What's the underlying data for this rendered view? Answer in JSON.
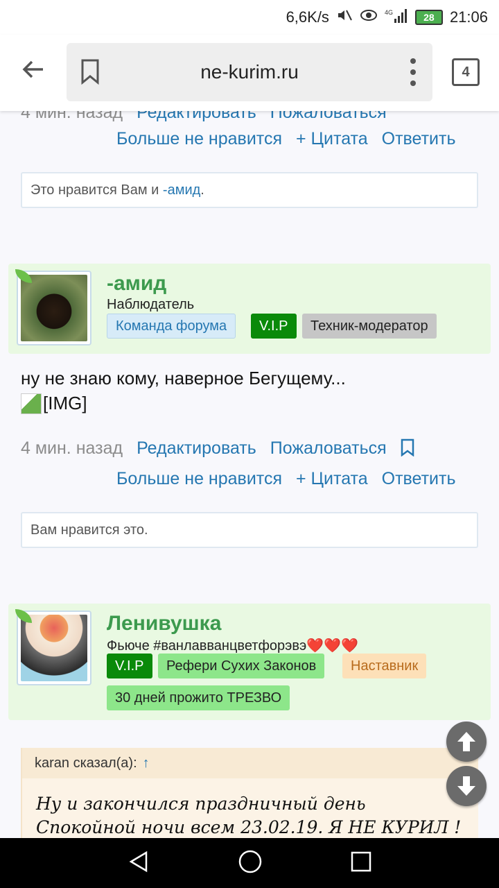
{
  "status_bar": {
    "speed": "6,6K/s",
    "network": "4G",
    "battery": "28",
    "time": "21:06"
  },
  "browser": {
    "url": "ne-kurim.ru",
    "tab_count": "4"
  },
  "post1": {
    "meta_time": "4 мин. назад",
    "edit": "Редактировать",
    "report": "Пожаловаться",
    "unlike": "Больше не нравится",
    "quote": "+ Цитата",
    "reply": "Ответить",
    "likes_prefix": "Это нравится Вам и ",
    "likes_user": "-амид",
    "likes_suffix": "."
  },
  "post2": {
    "username": "-амид",
    "user_title": "Наблюдатель",
    "badges": [
      {
        "label": "Команда форума",
        "bg": "#d7ebf8",
        "color": "#2577b1"
      },
      {
        "label": "V.I.P",
        "bg": "#0a8a0a",
        "color": "#ffffff"
      },
      {
        "label": "Техник-модератор",
        "bg": "#c6c6c6",
        "color": "#222222"
      }
    ],
    "text": "ну не знаю кому, наверное Бегущему...",
    "img_alt": "[IMG]",
    "meta_time": "4 мин. назад",
    "edit": "Редактировать",
    "report": "Пожаловаться",
    "unlike": "Больше не нравится",
    "quote": "+ Цитата",
    "reply": "Ответить",
    "likes_text": "Вам нравится это."
  },
  "post3": {
    "username": "Ленивушка",
    "user_title": "Фьюче #ванлавванцветфорэвэ❤️❤️❤️",
    "badges": [
      {
        "label": "V.I.P",
        "bg": "#0a8a0a",
        "color": "#ffffff"
      },
      {
        "label": "Рефери Сухих Законов",
        "bg": "#8de68a",
        "color": "#222222"
      },
      {
        "label": "Наставник",
        "bg": "#fde0b8",
        "color": "#b86b1c"
      },
      {
        "label": "30 дней прожито ТРЕЗВО",
        "bg": "#8de68a",
        "color": "#222222"
      }
    ],
    "quote_author": "karan сказал(а):",
    "quote_arrow": "↑",
    "quote_line1": "Ну и закончился праздничный день",
    "quote_line2": "Спокойной ночи всем 23.02.19. Я НЕ КУРИЛ !"
  },
  "colors": {
    "link": "#2577b1",
    "username": "#3c9a4e",
    "user_block_bg": "#e9f9e2"
  }
}
